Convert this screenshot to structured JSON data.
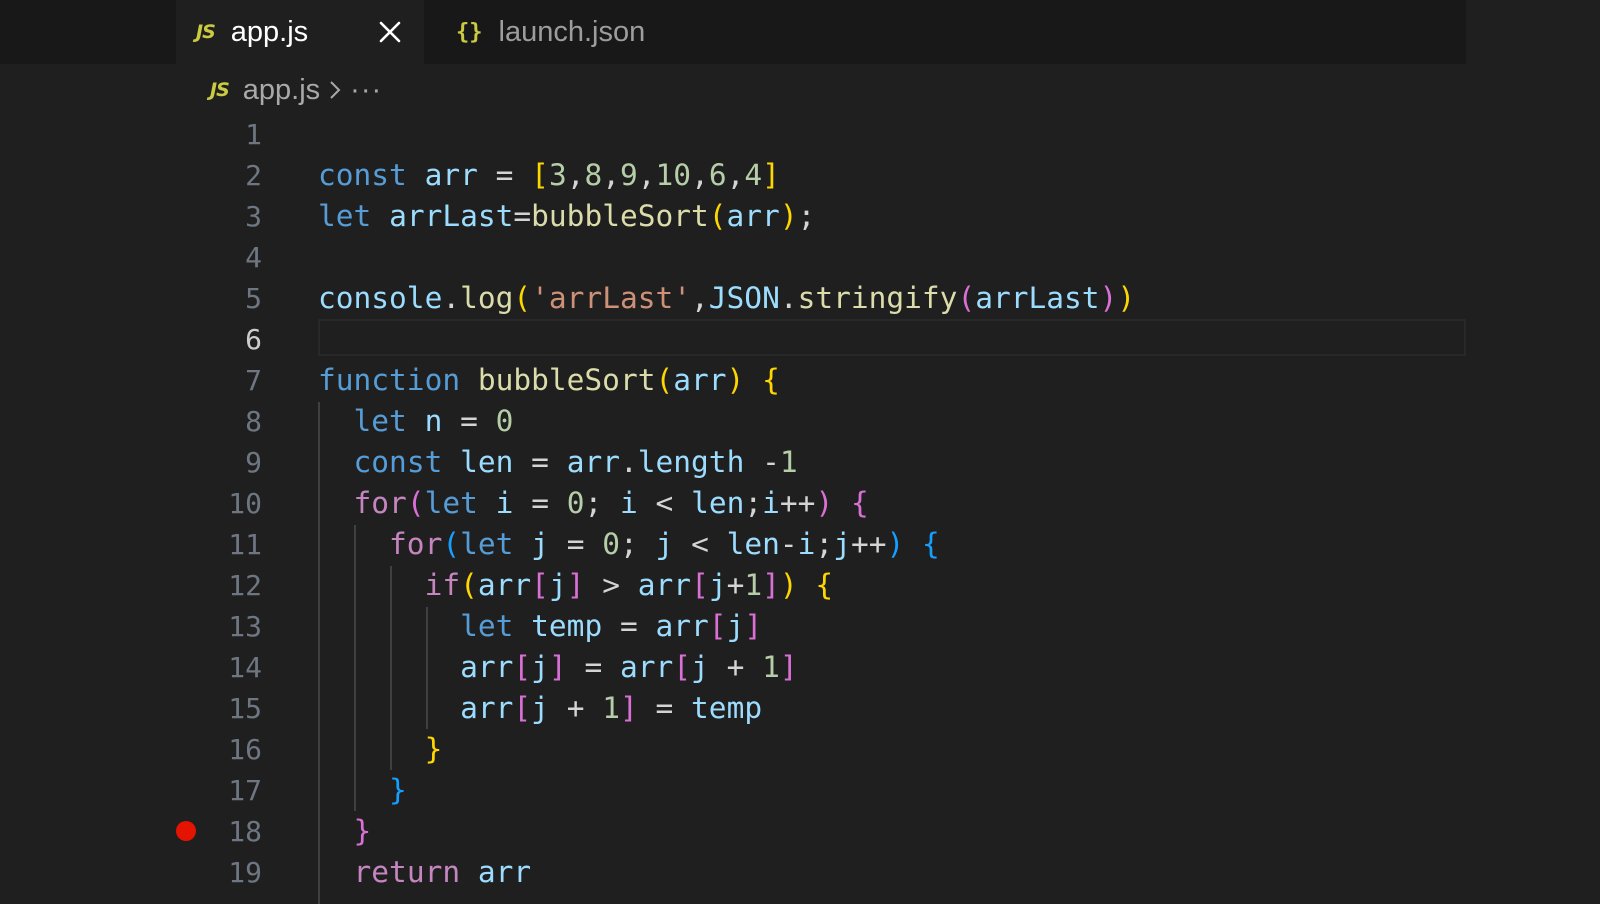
{
  "tabs": [
    {
      "icon": "JS",
      "label": "app.js",
      "active": true
    },
    {
      "icon": "{}",
      "label": "launch.json",
      "active": false
    }
  ],
  "breadcrumb": {
    "icon": "JS",
    "file": "app.js",
    "more": "···"
  },
  "lines": [
    {
      "n": "1",
      "code": ""
    },
    {
      "n": "2",
      "code": "const arr = [3,8,9,10,6,4]"
    },
    {
      "n": "3",
      "code": "let arrLast=bubbleSort(arr);"
    },
    {
      "n": "4",
      "code": ""
    },
    {
      "n": "5",
      "code": "console.log('arrLast',JSON.stringify(arrLast))"
    },
    {
      "n": "6",
      "code": "",
      "current": true
    },
    {
      "n": "7",
      "code": "function bubbleSort(arr) {"
    },
    {
      "n": "8",
      "code": "  let n = 0"
    },
    {
      "n": "9",
      "code": "  const len = arr.length -1"
    },
    {
      "n": "10",
      "code": "  for(let i = 0; i < len;i++) {"
    },
    {
      "n": "11",
      "code": "    for(let j = 0; j < len-i;j++) {"
    },
    {
      "n": "12",
      "code": "      if(arr[j] > arr[j+1]) {"
    },
    {
      "n": "13",
      "code": "        let temp = arr[j]"
    },
    {
      "n": "14",
      "code": "        arr[j] = arr[j + 1]"
    },
    {
      "n": "15",
      "code": "        arr[j + 1] = temp"
    },
    {
      "n": "16",
      "code": "      }"
    },
    {
      "n": "17",
      "code": "    }"
    },
    {
      "n": "18",
      "code": "  }",
      "breakpoint": true
    },
    {
      "n": "19",
      "code": "  return arr"
    }
  ],
  "colors": {
    "background": "#1f1f1f",
    "tabbar": "#181818",
    "breakpoint": "#e51400",
    "keyword": "#569cd6",
    "control": "#c586c0",
    "variable": "#9cdcfe",
    "function": "#dcdcaa",
    "number": "#b5cea8",
    "string": "#ce9178"
  }
}
